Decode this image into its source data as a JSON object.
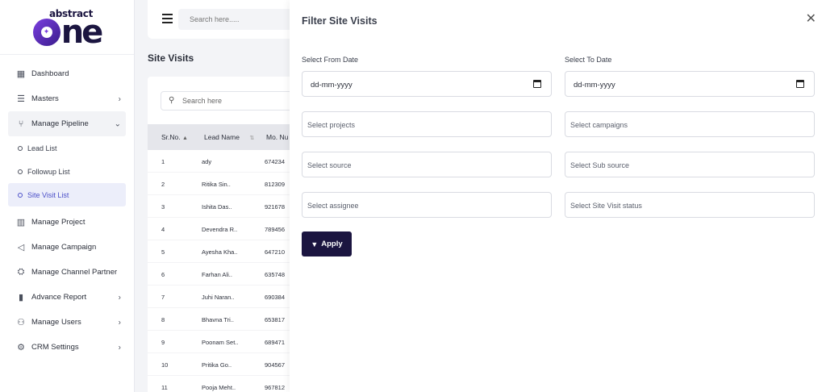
{
  "logo": {
    "top": "abstract",
    "bottom": "ne"
  },
  "sidebar": {
    "items": [
      {
        "label": "Dashboard",
        "icon": "dashboard-icon",
        "glyph": "▦"
      },
      {
        "label": "Masters",
        "icon": "list-icon",
        "glyph": "☰"
      },
      {
        "label": "Manage Pipeline",
        "icon": "pipeline-icon",
        "glyph": "⑂"
      },
      {
        "label": "Manage Project",
        "icon": "building-icon",
        "glyph": "▥"
      },
      {
        "label": "Manage Campaign",
        "icon": "megaphone-icon",
        "glyph": "📣"
      },
      {
        "label": "Manage Channel Partner",
        "icon": "handshake-icon",
        "glyph": "⛭"
      },
      {
        "label": "Advance Report",
        "icon": "bar-chart-icon",
        "glyph": "▮"
      },
      {
        "label": "Manage Users",
        "icon": "users-icon",
        "glyph": "⚇"
      },
      {
        "label": "CRM Settings",
        "icon": "gear-icon",
        "glyph": "⚙"
      }
    ],
    "sub_items": [
      "Lead List",
      "Followup List",
      "Site Visit List"
    ]
  },
  "topbar": {
    "search_placeholder": "Search here....."
  },
  "page": {
    "title": "Site Visits"
  },
  "list": {
    "search_placeholder": "Search here",
    "columns": [
      "Sr.No.",
      "Lead Name",
      "Mo. Nu"
    ],
    "rows": [
      {
        "sr": "1",
        "name": "ady",
        "mobile": "674234"
      },
      {
        "sr": "2",
        "name": "Ritika Sin..",
        "mobile": "812309"
      },
      {
        "sr": "3",
        "name": "Ishita Das..",
        "mobile": "921678"
      },
      {
        "sr": "4",
        "name": "Devendra R..",
        "mobile": "789456"
      },
      {
        "sr": "5",
        "name": "Ayesha Kha..",
        "mobile": "647210"
      },
      {
        "sr": "6",
        "name": "Farhan Ali..",
        "mobile": "635748"
      },
      {
        "sr": "7",
        "name": "Juhi Naran..",
        "mobile": "690384"
      },
      {
        "sr": "8",
        "name": "Bhavna Tri..",
        "mobile": "653817"
      },
      {
        "sr": "9",
        "name": "Poonam Set..",
        "mobile": "689471"
      },
      {
        "sr": "10",
        "name": "Pritika Go..",
        "mobile": "904567"
      },
      {
        "sr": "11",
        "name": "Pooja Meht..",
        "mobile": "967812"
      }
    ]
  },
  "filter": {
    "title": "Filter Site Visits",
    "from_label": "Select From Date",
    "to_label": "Select To Date",
    "from_value": "dd-mm-yyyy",
    "to_value": "dd-mm-yyyy",
    "projects": "Select projects",
    "campaigns": "Select campaigns",
    "source": "Select source",
    "sub_source": "Select Sub source",
    "assignee": "Select assignee",
    "status": "Select Site Visit status",
    "apply": "Apply"
  },
  "colors": {
    "primary": "#1b1540",
    "active_bg": "#eceefa",
    "active_text": "#4b4fc8"
  }
}
